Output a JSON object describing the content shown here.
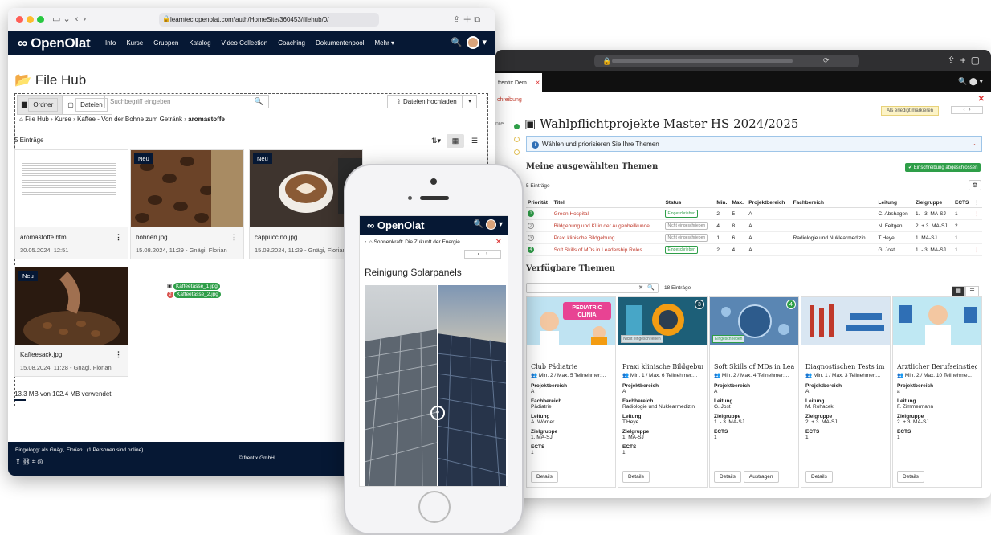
{
  "colors": {
    "navy": "#061834",
    "red": "#c0392b",
    "green": "#2e9e48",
    "blue": "#2f6fb5"
  },
  "desktop": {
    "url": "learntec.openolat.com/auth/HomeSite/360453/filehub/0/",
    "nav": {
      "logo": "OpenOlat",
      "menu": [
        "Info",
        "Kurse",
        "Gruppen",
        "Katalog",
        "Video Collection",
        "Coaching",
        "Dokumentenpool",
        "Mehr ▾"
      ]
    },
    "page_title": "File Hub",
    "toolbar": {
      "folders": "Ordner",
      "files": "Dateien",
      "search_placeholder": "Suchbegriff eingeben",
      "upload": "Dateien hochladen"
    },
    "breadcrumb": [
      "File Hub",
      "Kurse",
      "Kaffee - Von der Bohne zum Getränk",
      "aromastoffe"
    ],
    "count": "5 Einträge",
    "new_label": "Neu",
    "files": [
      {
        "name": "aromastoffe.html",
        "meta": "30.05.2024, 12:51",
        "new": false
      },
      {
        "name": "bohnen.jpg",
        "meta": "15.08.2024, 11:29 - Gnägi, Florian",
        "new": true
      },
      {
        "name": "cappuccino.jpg",
        "meta": "15.08.2024, 11:29 - Gnägi, Florian",
        "new": true
      },
      {
        "name": "Kaffeesack.jpg",
        "meta": "15.08.2024, 11:28 - Gnägi, Florian",
        "new": true
      }
    ],
    "drag": {
      "count": "2",
      "files": [
        "Kaffeetasse_1.jpg",
        "Kaffeetasse_2.jpg"
      ]
    },
    "usage": "13.3 MB von 102.4 MB verwendet",
    "footer": {
      "login_prefix": "Eingeloggt als",
      "user": "Gnägi, Florian",
      "online": "(1 Personen sind online)",
      "copyright": "© frentix GmbH"
    }
  },
  "phone": {
    "logo": "OpenOlat",
    "crumb": "Sonnenkraft: Die Zukunft der Energie",
    "title": "Reinigung Solarpanels"
  },
  "course": {
    "tab": "frentix Dem...",
    "red_link": "chreibung",
    "mark_done": "Als erledigt markieren",
    "side_label": "nre",
    "title": "Wahlpflichtprojekte Master HS 2024/2025",
    "info": "Wählen und priorisieren Sie Ihre Themen",
    "selected_heading": "Meine ausgewählten Themen",
    "enrolment_done": "Einschreibung abgeschlossen",
    "selected_count": "5 Einträge",
    "columns": [
      "Priorität",
      "Titel",
      "Status",
      "Min.",
      "Max.",
      "Projektbereich",
      "Fachbereich",
      "Leitung",
      "Zielgruppe",
      "ECTS"
    ],
    "rows": [
      {
        "prio": "1",
        "title": "Green Hospital",
        "status": "Eingeschrieben",
        "ok": true,
        "min": "2",
        "max": "5",
        "pb": "A",
        "fb": "",
        "lead": "C. Abshagen",
        "zg": "1. - 3. MA-SJ",
        "ects": "1",
        "menu": true
      },
      {
        "prio": "2",
        "title": "Bildgebung und KI in der Augenheilkunde",
        "status": "Nicht eingeschrieben",
        "ok": false,
        "min": "4",
        "max": "8",
        "pb": "A",
        "fb": "",
        "lead": "N. Feltgen",
        "zg": "2. + 3. MA-SJ",
        "ects": "2",
        "menu": false
      },
      {
        "prio": "3",
        "title": "Praxi klinische Bildgebung",
        "status": "Nicht eingeschrieben",
        "ok": false,
        "min": "1",
        "max": "6",
        "pb": "A",
        "fb": "Radiologie und Nuklearmedizin",
        "lead": "T.Heye",
        "zg": "1. MA-SJ",
        "ects": "1",
        "menu": false
      },
      {
        "prio": "4",
        "title": "Soft Skills of MDs in Leadership Roles",
        "status": "Eingeschrieben",
        "ok": true,
        "min": "2",
        "max": "4",
        "pb": "A",
        "fb": "",
        "lead": "G. Jost",
        "zg": "1. - 3. MA-SJ",
        "ects": "1",
        "menu": true
      }
    ],
    "available_heading": "Verfügbare Themen",
    "available_count": "18 Einträge",
    "card_labels": {
      "pb": "Projektbereich",
      "fb": "Fachbereich",
      "lead": "Leitung",
      "zg": "Zielgruppe",
      "ects": "ECTS",
      "details": "Details",
      "leave": "Austragen"
    },
    "cards": [
      {
        "title": "Club Pädiatrie",
        "people": "Min. 2 / Max. 5 Teilnehmer:...",
        "pb": "A",
        "fb": "Pädiatrie",
        "lead": "A. Wörner",
        "zg": "1. MA-SJ",
        "ects": "1",
        "img_text": "PEDIATRIC CLINIA"
      },
      {
        "title": "Praxi klinische Bildgebung",
        "people": "Min. 1 / Max. 6 Teilnehmer:...",
        "pb": "A",
        "fb": "Radiologie und Nuklearmedizin",
        "lead": "T.Heye",
        "zg": "1. MA-SJ",
        "ects": "1",
        "badge": "3",
        "tag": "Nicht eingeschrieben"
      },
      {
        "title": "Soft Skills of MDs in Leade...",
        "people": "Min. 2 / Max. 4 Teilnehmer:...",
        "pb": "A",
        "lead": "G. Jost",
        "zg": "1. - 3. MA-SJ",
        "ects": "1",
        "badge": "4",
        "tag": "Eingeschrieben"
      },
      {
        "title": "Diagnostischen Tests im kl...",
        "people": "Min. 1 / Max. 3 Teilnehmer:...",
        "pb": "A",
        "lead": "M. Rohacek",
        "zg": "2. + 3. MA-SJ",
        "ects": "1"
      },
      {
        "title": "Ärztlicher Berufseinstieg",
        "people": "Min. 2 / Max. 10 Teilnehme...",
        "pb": "a",
        "lead": "F. Zimmermann",
        "zg": "2. + 3. MA-SJ",
        "ects": "1"
      }
    ]
  }
}
